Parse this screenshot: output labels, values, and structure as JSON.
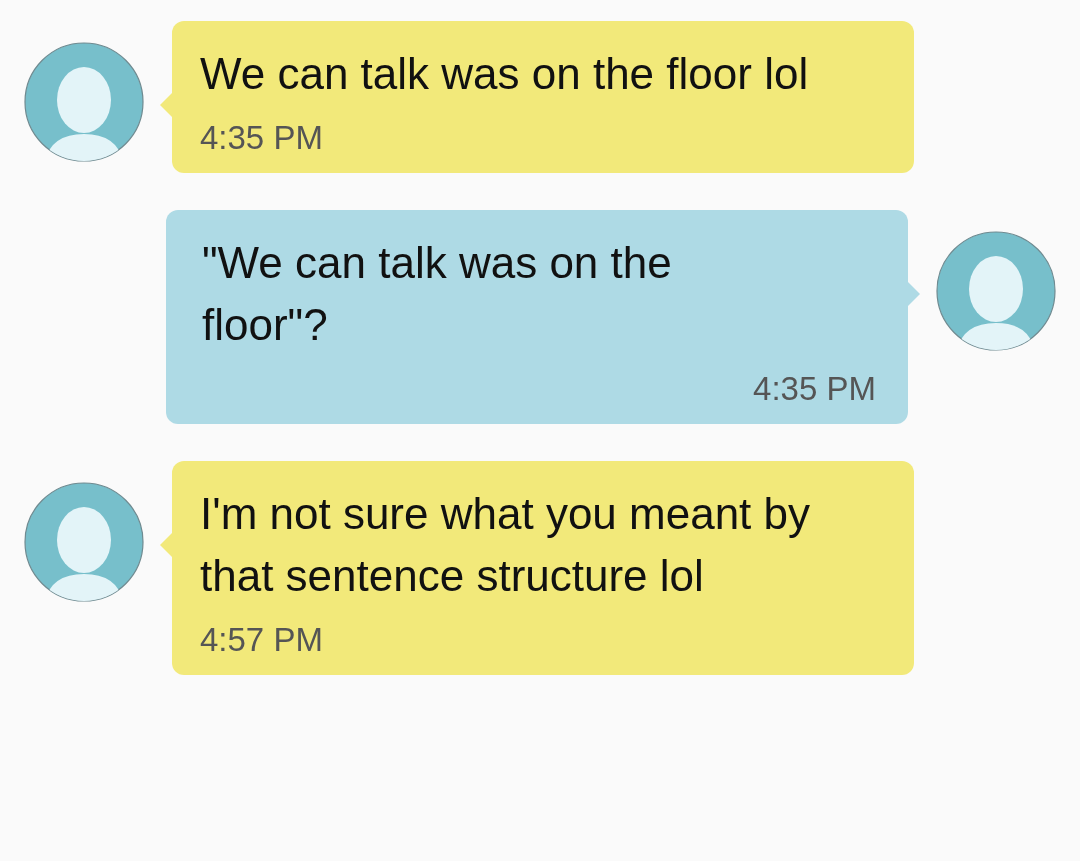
{
  "messages": [
    {
      "kind": "incoming",
      "text": "We can talk was on the floor lol",
      "time": "4:35 PM"
    },
    {
      "kind": "outgoing",
      "text": "\"We can talk was on the floor\"?",
      "time": "4:35 PM"
    },
    {
      "kind": "incoming",
      "text": "I'm not sure what you meant by that sentence structure lol",
      "time": "4:57 PM"
    }
  ]
}
